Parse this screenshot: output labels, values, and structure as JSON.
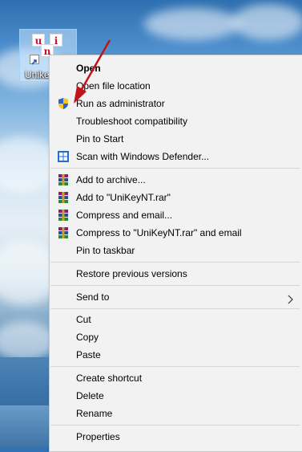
{
  "desktop": {
    "icon_label": "Unikey",
    "logo_letters": [
      "u",
      "i",
      "n"
    ]
  },
  "context_menu": {
    "open": "Open",
    "open_file_location": "Open file location",
    "run_as_administrator": "Run as administrator",
    "troubleshoot_compatibility": "Troubleshoot compatibility",
    "pin_to_start": "Pin to Start",
    "scan_with_defender": "Scan with Windows Defender...",
    "add_to_archive": "Add to archive...",
    "add_to_rar": "Add to \"UniKeyNT.rar\"",
    "compress_and_email": "Compress and email...",
    "compress_to_rar_and_email": "Compress to \"UniKeyNT.rar\" and email",
    "pin_to_taskbar": "Pin to taskbar",
    "restore_previous_versions": "Restore previous versions",
    "send_to": "Send to",
    "cut": "Cut",
    "copy": "Copy",
    "paste": "Paste",
    "create_shortcut": "Create shortcut",
    "delete": "Delete",
    "rename": "Rename",
    "properties": "Properties"
  },
  "colors": {
    "menu_background": "#f2f2f2",
    "annotation_arrow": "#c0141b",
    "unikey_red": "#c8102e"
  }
}
